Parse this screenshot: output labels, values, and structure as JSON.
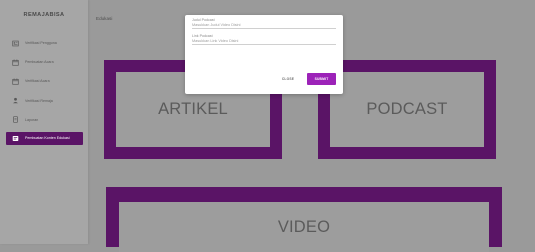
{
  "sidebar": {
    "brand": "REMAJABISA",
    "items": [
      {
        "label": "Verifikasi Pengguna",
        "icon": "user-card-icon"
      },
      {
        "label": "Pembuatan Acara",
        "icon": "calendar-icon"
      },
      {
        "label": "Verifikasi Acara",
        "icon": "calendar-icon"
      },
      {
        "label": "Verifikasi Remaja",
        "icon": "person-icon"
      },
      {
        "label": "Laporan",
        "icon": "document-icon"
      },
      {
        "label": "Pembuatan Konten Edukasi",
        "icon": "content-icon",
        "active": true
      }
    ]
  },
  "main": {
    "title": "Edukasi",
    "cards": {
      "artikel": "ARTIKEL",
      "podcast": "PODCAST",
      "video": "VIDEO"
    }
  },
  "modal": {
    "judul_label": "Judul Podcast",
    "judul_placeholder": "Masukkan Judul Video Disini",
    "link_label": "Link Podcast",
    "link_placeholder": "Masukkan Link Video Disini",
    "close_label": "CLOSE",
    "submit_label": "SUBMIT"
  },
  "colors": {
    "accent": "#5a1466",
    "submit": "#9c22b8",
    "overlay": "#9a9a9a"
  }
}
